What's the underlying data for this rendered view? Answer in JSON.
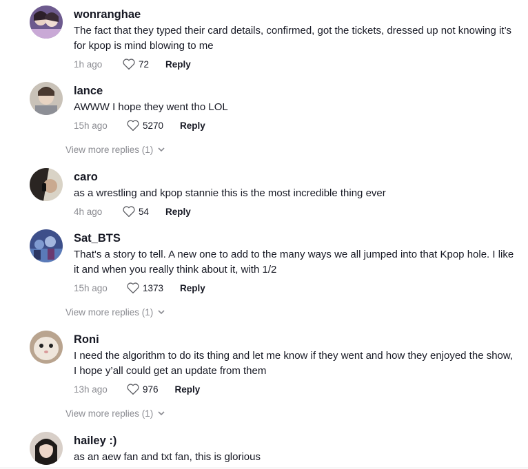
{
  "comments": [
    {
      "username": "wonranghae",
      "text": "The fact that they typed their card details, confirmed, got the tickets, dressed up not knowing it’s for kpop is mind blowing to me",
      "time": "1h ago",
      "likes": "72",
      "reply_label": "Reply"
    },
    {
      "username": "lance",
      "text": "AWWW I hope they went tho LOL",
      "time": "15h ago",
      "likes": "5270",
      "reply_label": "Reply"
    },
    {
      "username": "caro",
      "text": "as a wrestling and kpop stannie this is the most incredible thing ever",
      "time": "4h ago",
      "likes": "54",
      "reply_label": "Reply"
    },
    {
      "username": "Sat_BTS",
      "text": "That's a story to tell. A new one to add to the many ways we all jumped into that Kpop hole. I like it and when you really think about it, with 1/2",
      "time": "15h ago",
      "likes": "1373",
      "reply_label": "Reply"
    },
    {
      "username": "Roni",
      "text": "I need the algorithm to do its thing and let me know if they went and how they enjoyed the show, I hope y’all could get an update from them",
      "time": "13h ago",
      "likes": "976",
      "reply_label": "Reply"
    },
    {
      "username": "hailey :)",
      "text": "as an aew fan and txt fan, this is glorious"
    }
  ],
  "view_more": {
    "label": "View more replies (1)"
  },
  "icons": {
    "like": "heart-outline-icon",
    "expand": "chevron-down-icon"
  },
  "colors": {
    "text": "#161823",
    "muted": "#8a8b91",
    "background": "#ffffff"
  }
}
